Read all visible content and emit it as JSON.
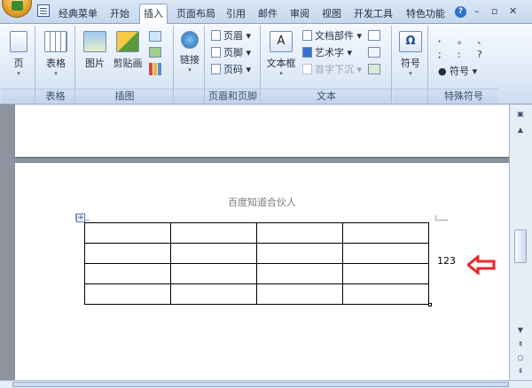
{
  "tabs": [
    "经典菜单",
    "开始",
    "插入",
    "页面布局",
    "引用",
    "邮件",
    "审阅",
    "视图",
    "开发工具",
    "特色功能"
  ],
  "active_tab": "插入",
  "window_controls": {
    "help": "?",
    "minimize": "–",
    "restore": "▫",
    "close": "✕"
  },
  "ribbon": {
    "groups": {
      "pages": {
        "label": "",
        "page_button": "页"
      },
      "tables": {
        "label": "表格",
        "table_button": "表格"
      },
      "illustrations": {
        "label": "插图",
        "picture_button": "图片",
        "clipart_button": "剪贴画"
      },
      "links": {
        "label": "",
        "link_button": "链接"
      },
      "header_footer": {
        "label": "页眉和页脚",
        "header": "页眉",
        "footer": "页脚",
        "page_number": "页码"
      },
      "text": {
        "label": "文本",
        "textbox": "文本框",
        "quick_parts": "文档部件",
        "wordart": "艺术字",
        "dropcap": "首字下沉"
      },
      "symbols": {
        "label": "",
        "symbol_button": "符号"
      },
      "special_symbols": {
        "label": "特殊符号",
        "symbol_chars": [
          ",",
          "。",
          "、",
          ";",
          ":",
          "?"
        ],
        "symbol_menu": "符号"
      }
    }
  },
  "document": {
    "header_text": "百度知道合伙人",
    "table": {
      "rows": 4,
      "cols": 4
    },
    "side_value": "123"
  },
  "colors": {
    "arrow": "#e8262b",
    "ribbon": "#dde8f6"
  }
}
